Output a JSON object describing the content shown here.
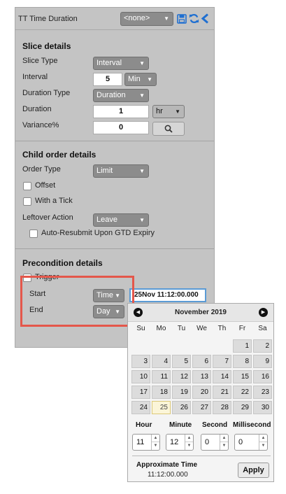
{
  "header": {
    "title": "TT Time Duration",
    "template_select": "<none>",
    "icons": [
      "save-icon",
      "refresh-icon",
      "back-chevron-icon"
    ],
    "accent_color": "#1f6fd1"
  },
  "slice": {
    "title": "Slice details",
    "slice_type_label": "Slice Type",
    "slice_type_value": "Interval",
    "interval_label": "Interval",
    "interval_value": "5",
    "interval_unit": "Min",
    "duration_type_label": "Duration Type",
    "duration_type_value": "Duration",
    "duration_label": "Duration",
    "duration_value": "1",
    "duration_unit": "hr",
    "variance_label": "Variance%",
    "variance_value": "0"
  },
  "child": {
    "title": "Child order details",
    "order_type_label": "Order Type",
    "order_type_value": "Limit",
    "offset_label": "Offset",
    "with_tick_label": "With a Tick",
    "leftover_label": "Leftover Action",
    "leftover_value": "Leave",
    "auto_resubmit_label": "Auto-Resubmit Upon GTD Expiry"
  },
  "precondition": {
    "title": "Precondition details",
    "trigger_label": "Trigger",
    "start_label": "Start",
    "start_type": "Time",
    "start_value": "25Nov 11:12:00.000",
    "end_label": "End",
    "end_type": "Day"
  },
  "calendar": {
    "month_label": "November 2019",
    "weekdays": [
      "Su",
      "Mo",
      "Tu",
      "We",
      "Th",
      "Fr",
      "Sa"
    ],
    "weeks": [
      [
        "",
        "",
        "",
        "",
        "",
        "1",
        "2"
      ],
      [
        "3",
        "4",
        "5",
        "6",
        "7",
        "8",
        "9"
      ],
      [
        "10",
        "11",
        "12",
        "13",
        "14",
        "15",
        "16"
      ],
      [
        "17",
        "18",
        "19",
        "20",
        "21",
        "22",
        "23"
      ],
      [
        "24",
        "25",
        "26",
        "27",
        "28",
        "29",
        "30"
      ]
    ],
    "today": "25",
    "hour_label": "Hour",
    "hour_value": "11",
    "minute_label": "Minute",
    "minute_value": "12",
    "second_label": "Second",
    "second_value": "0",
    "millisecond_label": "Millisecond",
    "millisecond_value": "0",
    "approx_label": "Approximate Time",
    "approx_value": "11:12:00.000",
    "apply_label": "Apply"
  },
  "highlight_color": "#e4574b"
}
